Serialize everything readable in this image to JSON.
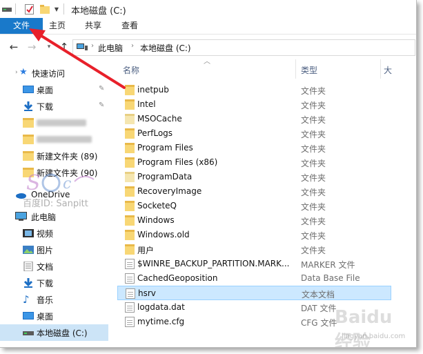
{
  "window": {
    "title": "本地磁盘 (C:)"
  },
  "ribbon": {
    "tabs": [
      "文件",
      "主页",
      "共享",
      "查看"
    ]
  },
  "address": {
    "crumbs": [
      "此电脑",
      "本地磁盘 (C:)"
    ]
  },
  "sidebar": {
    "quick_access": "快速访问",
    "items": [
      {
        "label": "桌面",
        "icon": "desktop-icon"
      },
      {
        "label": "下载",
        "icon": "download-icon"
      },
      {
        "label": "新建文件夹 (89)",
        "icon": "folder-icon"
      },
      {
        "label": "新建文件夹 (90)",
        "icon": "folder-icon"
      },
      {
        "label": "OneDrive",
        "icon": "onedrive-icon"
      },
      {
        "label": "此电脑",
        "icon": "computer-icon"
      },
      {
        "label": "视频",
        "icon": "video-icon"
      },
      {
        "label": "图片",
        "icon": "picture-icon"
      },
      {
        "label": "文档",
        "icon": "document-icon"
      },
      {
        "label": "下载",
        "icon": "download-icon"
      },
      {
        "label": "音乐",
        "icon": "music-icon"
      },
      {
        "label": "桌面",
        "icon": "desktop-icon"
      },
      {
        "label": "本地磁盘 (C:)",
        "icon": "drive-icon"
      }
    ]
  },
  "columns": {
    "name": "名称",
    "type": "类型",
    "size_partial": "大"
  },
  "files": [
    {
      "name": "inetpub",
      "type": "文件夹",
      "kind": "folder"
    },
    {
      "name": "Intel",
      "type": "文件夹",
      "kind": "folder"
    },
    {
      "name": "MSOCache",
      "type": "文件夹",
      "kind": "folder-pale"
    },
    {
      "name": "PerfLogs",
      "type": "文件夹",
      "kind": "folder"
    },
    {
      "name": "Program Files",
      "type": "文件夹",
      "kind": "folder"
    },
    {
      "name": "Program Files (x86)",
      "type": "文件夹",
      "kind": "folder"
    },
    {
      "name": "ProgramData",
      "type": "文件夹",
      "kind": "folder-pale"
    },
    {
      "name": "RecoveryImage",
      "type": "文件夹",
      "kind": "folder"
    },
    {
      "name": "SocketeQ",
      "type": "文件夹",
      "kind": "folder"
    },
    {
      "name": "Windows",
      "type": "文件夹",
      "kind": "folder"
    },
    {
      "name": "Windows.old",
      "type": "文件夹",
      "kind": "folder"
    },
    {
      "name": "用户",
      "type": "文件夹",
      "kind": "folder"
    },
    {
      "name": "$WINRE_BACKUP_PARTITION.MARK...",
      "type": "MARKER 文件",
      "kind": "doc"
    },
    {
      "name": "CachedGeoposition",
      "type": "Data Base File",
      "kind": "doc"
    },
    {
      "name": "hsrv",
      "type": "文本文档",
      "kind": "doc"
    },
    {
      "name": "logdata.dat",
      "type": "DAT 文件",
      "kind": "doc"
    },
    {
      "name": "mytime.cfg",
      "type": "CFG 文件",
      "kind": "doc"
    }
  ],
  "watermarks": {
    "sanpitt": "百度ID: Sanpitt",
    "baidu": "Baidu 经验",
    "url": "jingyan.baidu.com"
  },
  "colors": {
    "file_tab": "#1979ca",
    "selection": "#cce8ff",
    "annotation_arrow": "#e8202a"
  }
}
